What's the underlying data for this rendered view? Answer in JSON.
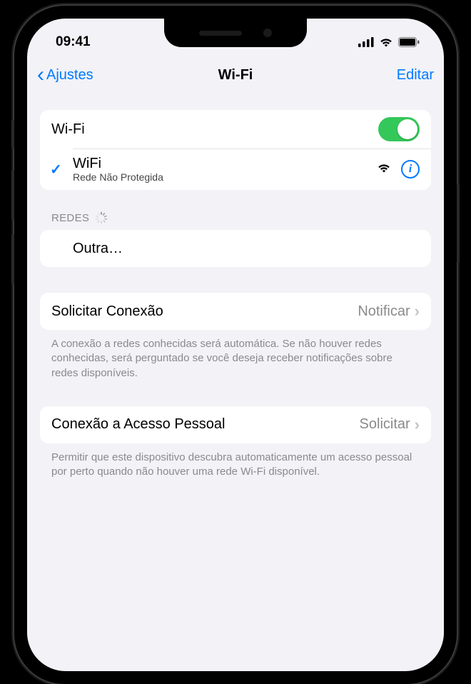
{
  "status": {
    "time": "09:41"
  },
  "nav": {
    "back": "Ajustes",
    "title": "Wi-Fi",
    "edit": "Editar"
  },
  "wifi": {
    "toggle_label": "Wi-Fi",
    "toggle_on": true,
    "current_network": {
      "name": "WiFi",
      "subtitle": "Rede Não Protegida"
    }
  },
  "networks": {
    "header": "REDES",
    "other": "Outra…"
  },
  "ask_to_join": {
    "label": "Solicitar Conexão",
    "value": "Notificar",
    "footer": "A conexão a redes conhecidas será automática. Se não houver redes conhecidas, será perguntado se você deseja receber notificações sobre redes disponíveis."
  },
  "hotspot": {
    "label": "Conexão a Acesso Pessoal",
    "value": "Solicitar",
    "footer": "Permitir que este dispositivo descubra automaticamente um acesso pessoal por perto quando não houver uma rede Wi-Fi disponível."
  }
}
